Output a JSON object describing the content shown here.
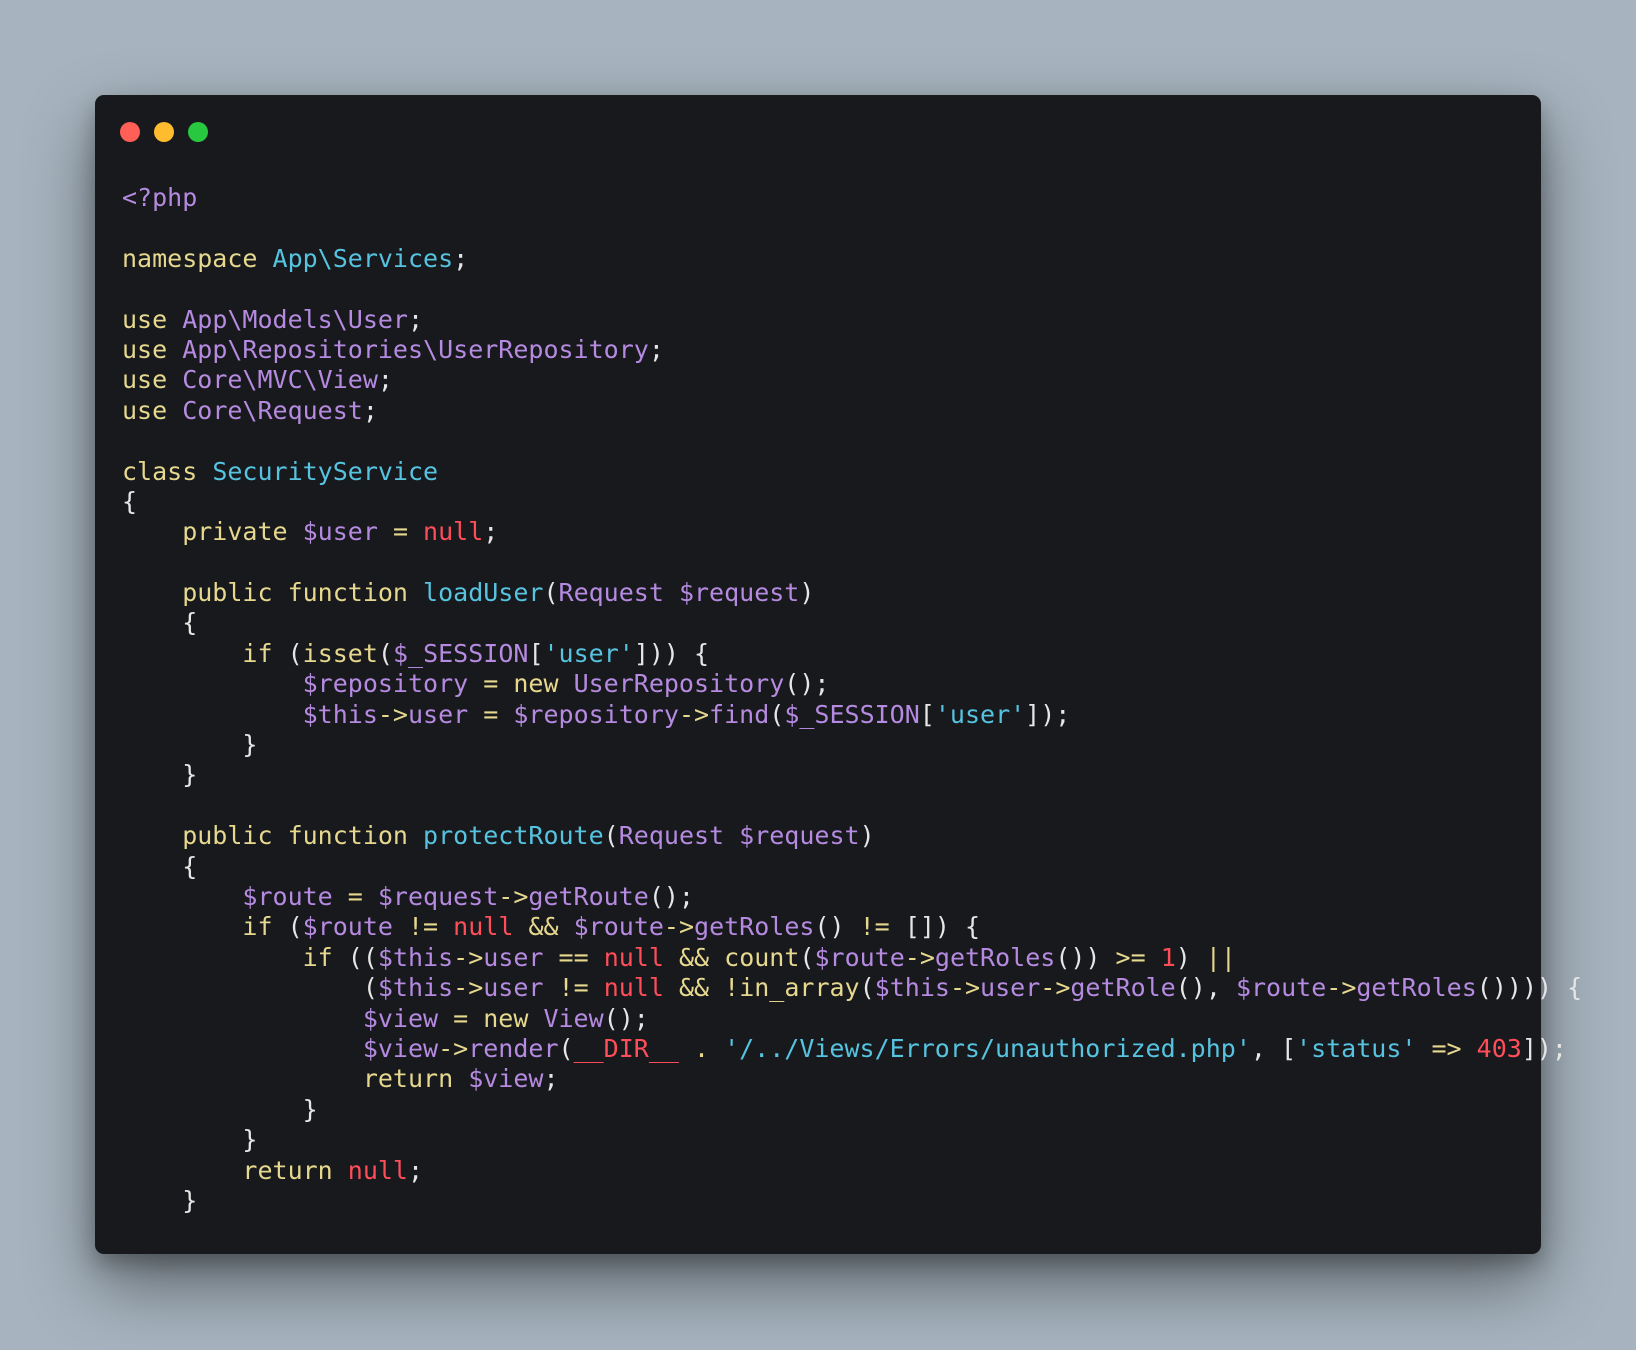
{
  "window": {
    "controls": {
      "close_color": "#ff5f57",
      "minimize_color": "#febc2e",
      "maximize_color": "#28c840"
    }
  },
  "code": {
    "language": "php",
    "lines": [
      [
        {
          "t": "<?php",
          "c": "tag"
        }
      ],
      [],
      [
        {
          "t": "namespace ",
          "c": "kw"
        },
        {
          "t": "App\\Services",
          "c": "cls"
        },
        {
          "t": ";",
          "c": "txt"
        }
      ],
      [],
      [
        {
          "t": "use ",
          "c": "kw"
        },
        {
          "t": "App\\Models\\User",
          "c": "ns"
        },
        {
          "t": ";",
          "c": "txt"
        }
      ],
      [
        {
          "t": "use ",
          "c": "kw"
        },
        {
          "t": "App\\Repositories\\UserRepository",
          "c": "ns"
        },
        {
          "t": ";",
          "c": "txt"
        }
      ],
      [
        {
          "t": "use ",
          "c": "kw"
        },
        {
          "t": "Core\\MVC\\View",
          "c": "ns"
        },
        {
          "t": ";",
          "c": "txt"
        }
      ],
      [
        {
          "t": "use ",
          "c": "kw"
        },
        {
          "t": "Core\\Request",
          "c": "ns"
        },
        {
          "t": ";",
          "c": "txt"
        }
      ],
      [],
      [
        {
          "t": "class ",
          "c": "kw"
        },
        {
          "t": "SecurityService",
          "c": "cls"
        }
      ],
      [
        {
          "t": "{",
          "c": "txt"
        }
      ],
      [
        {
          "t": "    private ",
          "c": "kw"
        },
        {
          "t": "$user",
          "c": "var"
        },
        {
          "t": " = ",
          "c": "op"
        },
        {
          "t": "null",
          "c": "nul"
        },
        {
          "t": ";",
          "c": "txt"
        }
      ],
      [],
      [
        {
          "t": "    public ",
          "c": "kw"
        },
        {
          "t": "function ",
          "c": "kw"
        },
        {
          "t": "loadUser",
          "c": "fn"
        },
        {
          "t": "(",
          "c": "txt"
        },
        {
          "t": "Request ",
          "c": "ns"
        },
        {
          "t": "$request",
          "c": "var"
        },
        {
          "t": ")",
          "c": "txt"
        }
      ],
      [
        {
          "t": "    {",
          "c": "txt"
        }
      ],
      [
        {
          "t": "        if ",
          "c": "kw"
        },
        {
          "t": "(",
          "c": "txt"
        },
        {
          "t": "isset",
          "c": "builtin"
        },
        {
          "t": "(",
          "c": "txt"
        },
        {
          "t": "$_SESSION",
          "c": "var"
        },
        {
          "t": "[",
          "c": "txt"
        },
        {
          "t": "'user'",
          "c": "str"
        },
        {
          "t": "])) {",
          "c": "txt"
        }
      ],
      [
        {
          "t": "            $repository",
          "c": "var"
        },
        {
          "t": " = ",
          "c": "op"
        },
        {
          "t": "new ",
          "c": "kw"
        },
        {
          "t": "UserRepository",
          "c": "ns"
        },
        {
          "t": "();",
          "c": "txt"
        }
      ],
      [
        {
          "t": "            $this",
          "c": "var"
        },
        {
          "t": "->",
          "c": "op"
        },
        {
          "t": "user",
          "c": "var"
        },
        {
          "t": " = ",
          "c": "op"
        },
        {
          "t": "$repository",
          "c": "var"
        },
        {
          "t": "->",
          "c": "op"
        },
        {
          "t": "find",
          "c": "ns"
        },
        {
          "t": "(",
          "c": "txt"
        },
        {
          "t": "$_SESSION",
          "c": "var"
        },
        {
          "t": "[",
          "c": "txt"
        },
        {
          "t": "'user'",
          "c": "str"
        },
        {
          "t": "]);",
          "c": "txt"
        }
      ],
      [
        {
          "t": "        }",
          "c": "txt"
        }
      ],
      [
        {
          "t": "    }",
          "c": "txt"
        }
      ],
      [],
      [
        {
          "t": "    public ",
          "c": "kw"
        },
        {
          "t": "function ",
          "c": "kw"
        },
        {
          "t": "protectRoute",
          "c": "fn"
        },
        {
          "t": "(",
          "c": "txt"
        },
        {
          "t": "Request ",
          "c": "ns"
        },
        {
          "t": "$request",
          "c": "var"
        },
        {
          "t": ")",
          "c": "txt"
        }
      ],
      [
        {
          "t": "    {",
          "c": "txt"
        }
      ],
      [
        {
          "t": "        $route",
          "c": "var"
        },
        {
          "t": " = ",
          "c": "op"
        },
        {
          "t": "$request",
          "c": "var"
        },
        {
          "t": "->",
          "c": "op"
        },
        {
          "t": "getRoute",
          "c": "ns"
        },
        {
          "t": "();",
          "c": "txt"
        }
      ],
      [
        {
          "t": "        if ",
          "c": "kw"
        },
        {
          "t": "(",
          "c": "txt"
        },
        {
          "t": "$route",
          "c": "var"
        },
        {
          "t": " != ",
          "c": "op"
        },
        {
          "t": "null",
          "c": "nul"
        },
        {
          "t": " && ",
          "c": "op"
        },
        {
          "t": "$route",
          "c": "var"
        },
        {
          "t": "->",
          "c": "op"
        },
        {
          "t": "getRoles",
          "c": "ns"
        },
        {
          "t": "() ",
          "c": "txt"
        },
        {
          "t": "!=",
          "c": "op"
        },
        {
          "t": " []) {",
          "c": "txt"
        }
      ],
      [
        {
          "t": "            if ",
          "c": "kw"
        },
        {
          "t": "((",
          "c": "txt"
        },
        {
          "t": "$this",
          "c": "var"
        },
        {
          "t": "->",
          "c": "op"
        },
        {
          "t": "user",
          "c": "var"
        },
        {
          "t": " == ",
          "c": "op"
        },
        {
          "t": "null",
          "c": "nul"
        },
        {
          "t": " && ",
          "c": "op"
        },
        {
          "t": "count",
          "c": "builtin"
        },
        {
          "t": "(",
          "c": "txt"
        },
        {
          "t": "$route",
          "c": "var"
        },
        {
          "t": "->",
          "c": "op"
        },
        {
          "t": "getRoles",
          "c": "ns"
        },
        {
          "t": "()) ",
          "c": "txt"
        },
        {
          "t": ">=",
          "c": "op"
        },
        {
          "t": " ",
          "c": "txt"
        },
        {
          "t": "1",
          "c": "num"
        },
        {
          "t": ") ",
          "c": "txt"
        },
        {
          "t": "||",
          "c": "op"
        }
      ],
      [
        {
          "t": "                (",
          "c": "txt"
        },
        {
          "t": "$this",
          "c": "var"
        },
        {
          "t": "->",
          "c": "op"
        },
        {
          "t": "user",
          "c": "var"
        },
        {
          "t": " != ",
          "c": "op"
        },
        {
          "t": "null",
          "c": "nul"
        },
        {
          "t": " && ",
          "c": "op"
        },
        {
          "t": "!",
          "c": "op"
        },
        {
          "t": "in_array",
          "c": "builtin"
        },
        {
          "t": "(",
          "c": "txt"
        },
        {
          "t": "$this",
          "c": "var"
        },
        {
          "t": "->",
          "c": "op"
        },
        {
          "t": "user",
          "c": "var"
        },
        {
          "t": "->",
          "c": "op"
        },
        {
          "t": "getRole",
          "c": "ns"
        },
        {
          "t": "(), ",
          "c": "txt"
        },
        {
          "t": "$route",
          "c": "var"
        },
        {
          "t": "->",
          "c": "op"
        },
        {
          "t": "getRoles",
          "c": "ns"
        },
        {
          "t": "()))) {",
          "c": "txt"
        }
      ],
      [
        {
          "t": "                $view",
          "c": "var"
        },
        {
          "t": " = ",
          "c": "op"
        },
        {
          "t": "new ",
          "c": "kw"
        },
        {
          "t": "View",
          "c": "ns"
        },
        {
          "t": "();",
          "c": "txt"
        }
      ],
      [
        {
          "t": "                $view",
          "c": "var"
        },
        {
          "t": "->",
          "c": "op"
        },
        {
          "t": "render",
          "c": "ns"
        },
        {
          "t": "(",
          "c": "txt"
        },
        {
          "t": "__DIR__",
          "c": "const"
        },
        {
          "t": " . ",
          "c": "op"
        },
        {
          "t": "'/../Views/Errors/unauthorized.php'",
          "c": "str"
        },
        {
          "t": ", [",
          "c": "txt"
        },
        {
          "t": "'status'",
          "c": "str"
        },
        {
          "t": " => ",
          "c": "op"
        },
        {
          "t": "403",
          "c": "num"
        },
        {
          "t": "]);",
          "c": "txt"
        }
      ],
      [
        {
          "t": "                return ",
          "c": "kw"
        },
        {
          "t": "$view",
          "c": "var"
        },
        {
          "t": ";",
          "c": "txt"
        }
      ],
      [
        {
          "t": "            }",
          "c": "txt"
        }
      ],
      [
        {
          "t": "        }",
          "c": "txt"
        }
      ],
      [
        {
          "t": "        return ",
          "c": "kw"
        },
        {
          "t": "null",
          "c": "nul"
        },
        {
          "t": ";",
          "c": "txt"
        }
      ],
      [
        {
          "t": "    }",
          "c": "txt"
        }
      ]
    ]
  }
}
